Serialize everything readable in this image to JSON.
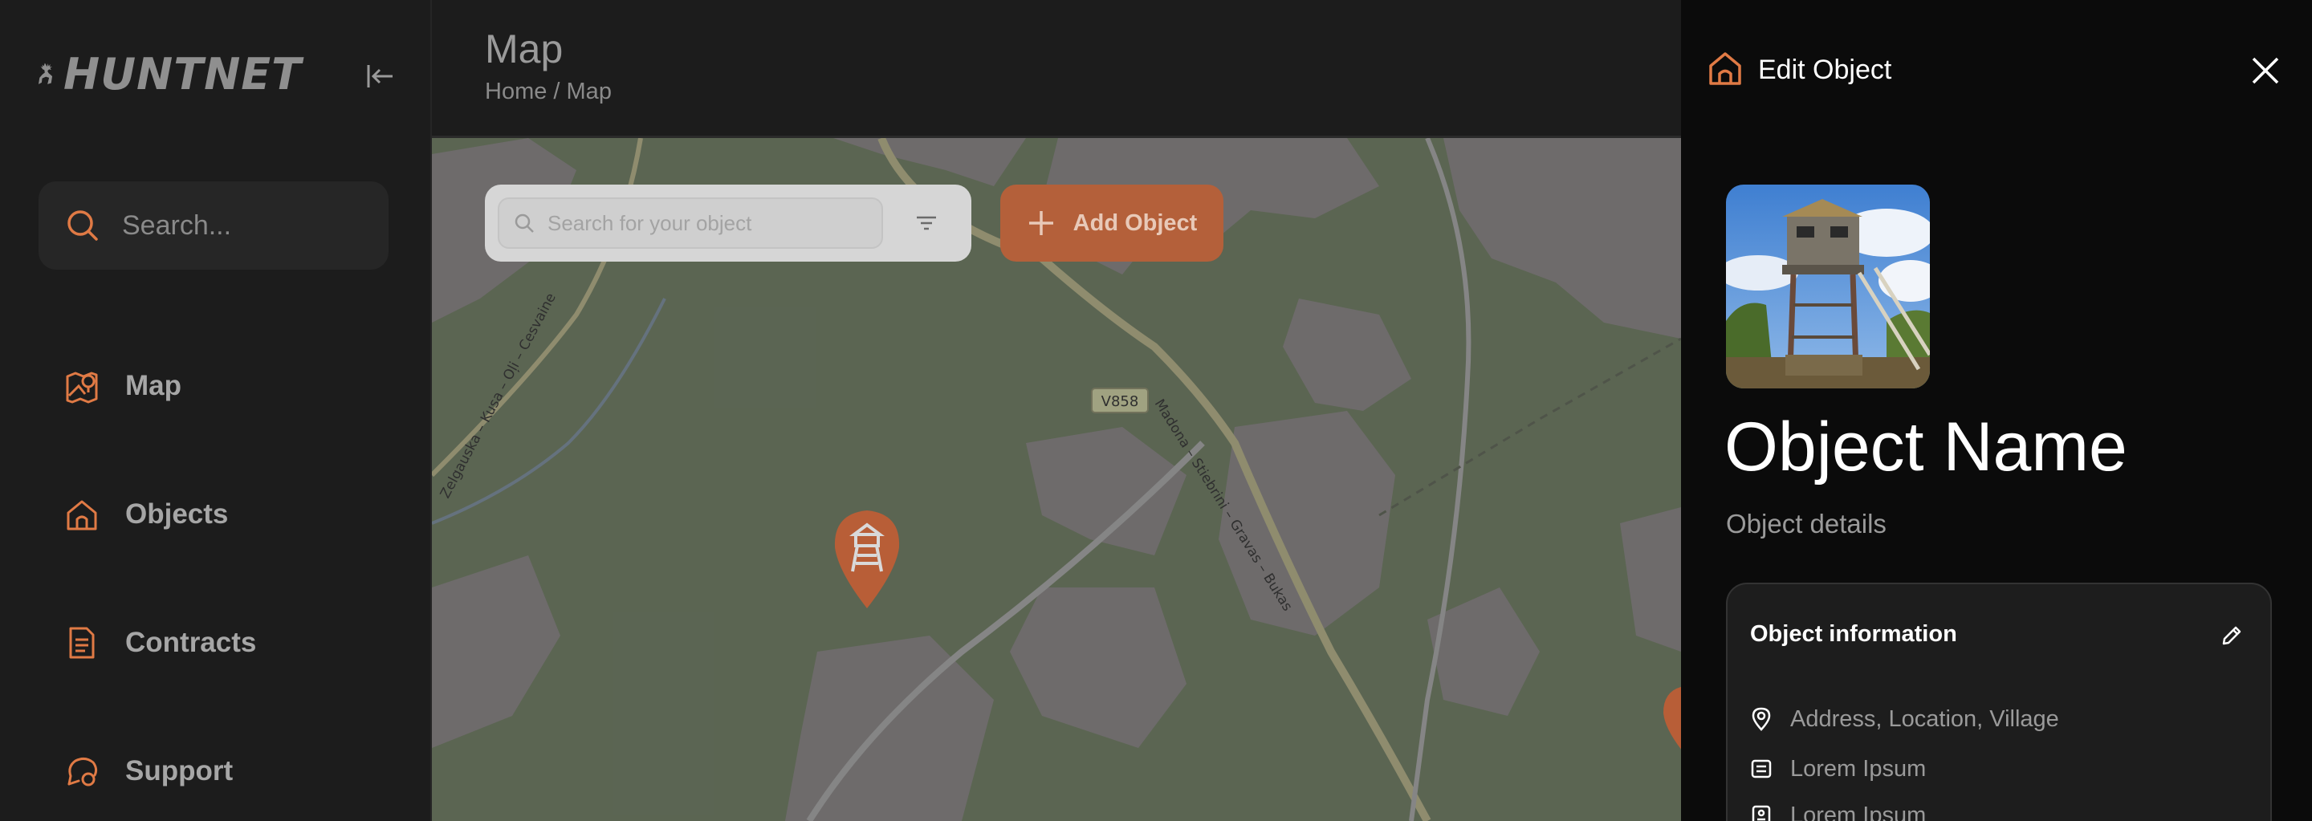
{
  "app": {
    "brand": "HUNTNET"
  },
  "sidebar": {
    "search_placeholder": "Search...",
    "items": [
      {
        "label": "Map",
        "icon": "map-pin-icon"
      },
      {
        "label": "Objects",
        "icon": "home-icon"
      },
      {
        "label": "Contracts",
        "icon": "document-icon"
      },
      {
        "label": "Support",
        "icon": "chat-bubble-icon"
      }
    ]
  },
  "header": {
    "title": "Map",
    "breadcrumb": "Home / Map"
  },
  "map": {
    "search_placeholder": "Search for your object",
    "add_button_label": "Add Object",
    "road_label": "V858",
    "street_labels": [
      "Madona – Stiebrini – Gravas – Bukas",
      "Zelgauska – Kusa – Oļi – Cesvaine"
    ]
  },
  "panel": {
    "title": "Edit Object",
    "object_name": "Object Name",
    "object_details": "Object details",
    "info": {
      "title": "Object information",
      "address": "Address, Location, Village",
      "line1": "Lorem Ipsum",
      "line2": "Lorem Ipsum"
    }
  },
  "colors": {
    "accent": "#e07a45",
    "background": "#1c1c1c",
    "panel": "#0b0b0b"
  }
}
